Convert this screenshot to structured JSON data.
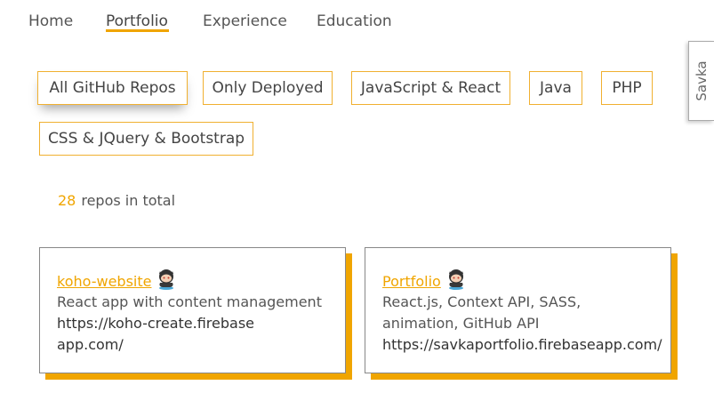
{
  "nav": {
    "items": [
      {
        "label": "Home"
      },
      {
        "label": "Portfolio"
      },
      {
        "label": "Experience"
      },
      {
        "label": "Education"
      }
    ]
  },
  "filters": [
    {
      "label": "All GitHub Repos"
    },
    {
      "label": "Only Deployed"
    },
    {
      "label": "JavaScript & React"
    },
    {
      "label": "Java"
    },
    {
      "label": "PHP"
    },
    {
      "label": "CSS & JQuery & Bootstrap"
    }
  ],
  "summary": {
    "count": "28",
    "text": "repos in total"
  },
  "repos": [
    {
      "name": "koho-website",
      "description": "React app with content management",
      "url": "https://koho-create.firebaseapp.com/"
    },
    {
      "name": "Portfolio",
      "description": "React.js, Context API, SASS, animation, GitHub API",
      "url": "https://savkaportfolio.firebaseapp.com/"
    }
  ],
  "side_tab": {
    "label": "Savka"
  },
  "colors": {
    "accent": "#f0a500",
    "border": "#888888"
  },
  "icons": {
    "repo": "github-octocat-icon"
  }
}
